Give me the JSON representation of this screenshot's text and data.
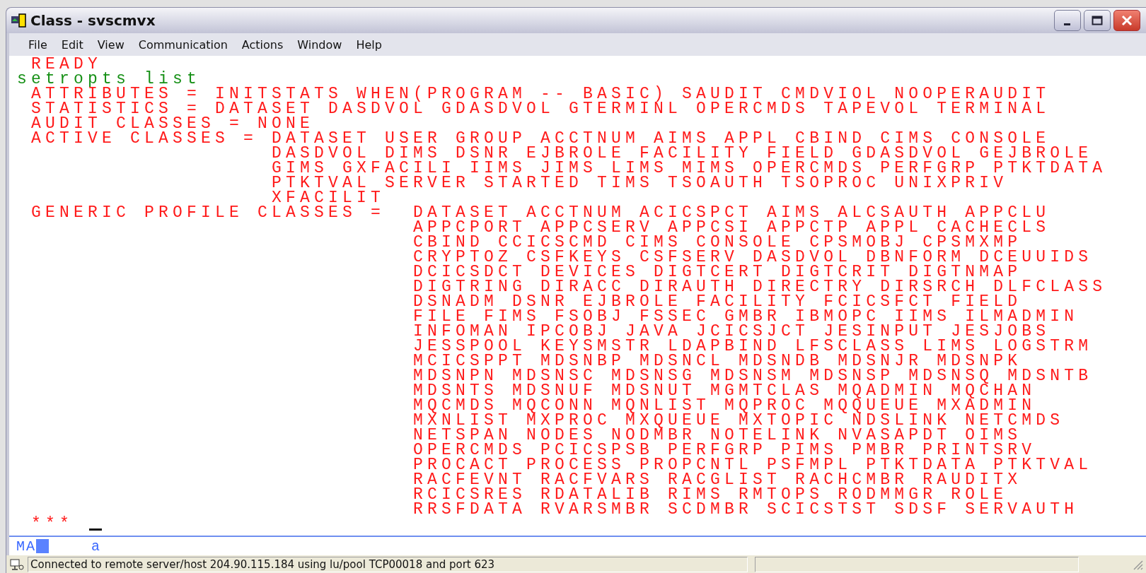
{
  "window": {
    "title": "Class - svscmvx"
  },
  "menu": [
    "File",
    "Edit",
    "View",
    "Communication",
    "Actions",
    "Window",
    "Help"
  ],
  "terminal": {
    "lines": [
      {
        "text": " READY",
        "kind": "output"
      },
      {
        "text": "setropts list",
        "kind": "input"
      },
      {
        "text": " ATTRIBUTES = INITSTATS WHEN(PROGRAM -- BASIC) SAUDIT CMDVIOL NOOPERAUDIT",
        "kind": "output"
      },
      {
        "text": " STATISTICS = DATASET DASDVOL GDASDVOL GTERMINL OPERCMDS TAPEVOL TERMINAL",
        "kind": "output"
      },
      {
        "text": " AUDIT CLASSES = NONE",
        "kind": "output"
      },
      {
        "text": " ACTIVE CLASSES = DATASET USER GROUP ACCTNUM AIMS APPL CBIND CIMS CONSOLE",
        "kind": "output"
      },
      {
        "text": "                  DASDVOL DIMS DSNR EJBROLE FACILITY FIELD GDASDVOL GEJBROLE",
        "kind": "output"
      },
      {
        "text": "                  GIMS GXFACILI IIMS JIMS LIMS MIMS OPERCMDS PERFGRP PTKTDATA",
        "kind": "output"
      },
      {
        "text": "                  PTKTVAL SERVER STARTED TIMS TSOAUTH TSOPROC UNIXPRIV",
        "kind": "output"
      },
      {
        "text": "                  XFACILIT",
        "kind": "output"
      },
      {
        "text": " GENERIC PROFILE CLASSES =  DATASET ACCTNUM ACICSPCT AIMS ALCSAUTH APPCLU",
        "kind": "output"
      },
      {
        "text": "                            APPCPORT APPCSERV APPCSI APPCTP APPL CACHECLS",
        "kind": "output"
      },
      {
        "text": "                            CBIND CCICSCMD CIMS CONSOLE CPSMOBJ CPSMXMP",
        "kind": "output"
      },
      {
        "text": "                            CRYPTOZ CSFKEYS CSFSERV DASDVOL DBNFORM DCEUUIDS",
        "kind": "output"
      },
      {
        "text": "                            DCICSDCT DEVICES DIGTCERT DIGTCRIT DIGTNMAP",
        "kind": "output"
      },
      {
        "text": "                            DIGTRING DIRACC DIRAUTH DIRECTRY DIRSRCH DLFCLASS",
        "kind": "output"
      },
      {
        "text": "                            DSNADM DSNR EJBROLE FACILITY FCICSFCT FIELD",
        "kind": "output"
      },
      {
        "text": "                            FILE FIMS FSOBJ FSSEC GMBR IBMOPC IIMS ILMADMIN",
        "kind": "output"
      },
      {
        "text": "                            INFOMAN IPCOBJ JAVA JCICSJCT JESINPUT JESJOBS",
        "kind": "output"
      },
      {
        "text": "                            JESSPOOL KEYSMSTR LDAPBIND LFSCLASS LIMS LOGSTRM",
        "kind": "output"
      },
      {
        "text": "                            MCICSPPT MDSNBP MDSNCL MDSNDB MDSNJR MDSNPK",
        "kind": "output"
      },
      {
        "text": "                            MDSNPN MDSNSC MDSNSG MDSNSM MDSNSP MDSNSQ MDSNTB",
        "kind": "output"
      },
      {
        "text": "                            MDSNTS MDSNUF MDSNUT MGMTCLAS MQADMIN MQCHAN",
        "kind": "output"
      },
      {
        "text": "                            MQCMDS MQCONN MQNLIST MQPROC MQQUEUE MXADMIN",
        "kind": "output"
      },
      {
        "text": "                            MXNLIST MXPROC MXQUEUE MXTOPIC NDSLINK NETCMDS",
        "kind": "output"
      },
      {
        "text": "                            NETSPAN NODES NODMBR NOTELINK NVASAPDT OIMS",
        "kind": "output"
      },
      {
        "text": "                            OPERCMDS PCICSPSB PERFGRP PIMS PMBR PRINTSRV",
        "kind": "output"
      },
      {
        "text": "                            PROCACT PROCESS PROPCNTL PSFMPL PTKTDATA PTKTVAL",
        "kind": "output"
      },
      {
        "text": "                            RACFEVNT RACFVARS RACGLIST RACHCMBR RAUDITX",
        "kind": "output"
      },
      {
        "text": "                            RCICSRES RDATALIB RIMS RMTOPS RODMMGR ROLE",
        "kind": "output"
      },
      {
        "text": "                            RRSFDATA RVARSMBR SCDMBR SCICSTST SDSF SERVAUTH",
        "kind": "output"
      },
      {
        "text": " ***",
        "kind": "output"
      }
    ]
  },
  "oia": {
    "mode": "MA",
    "field": "a"
  },
  "status_bar": {
    "text": "Connected to remote server/host 204.90.115.184 using lu/pool TCP00018 and port 623"
  }
}
